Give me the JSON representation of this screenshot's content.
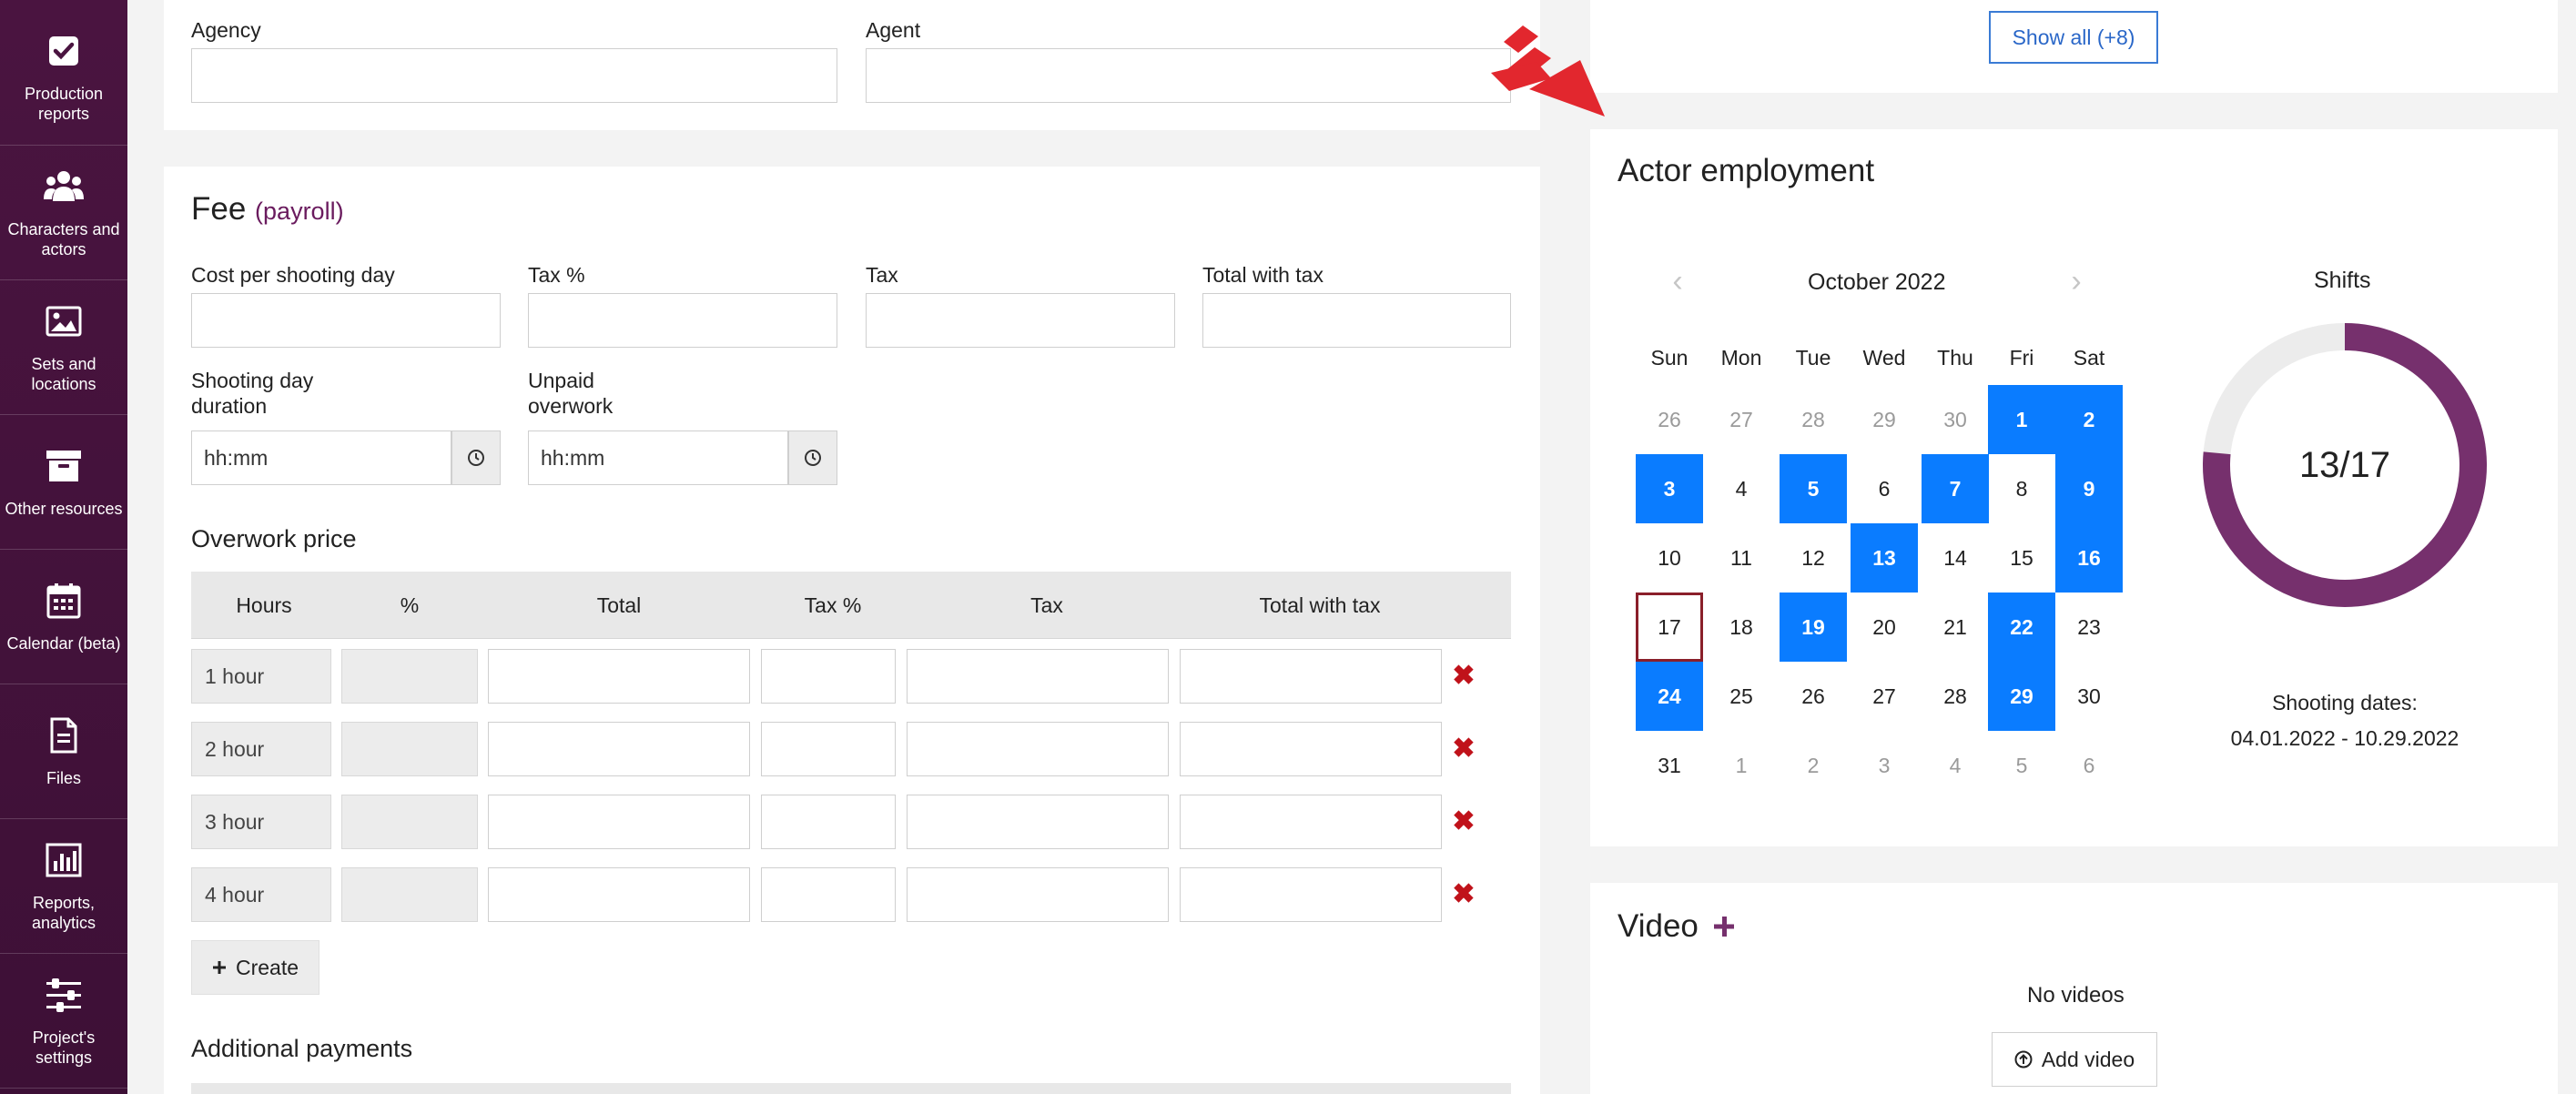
{
  "sidebar": {
    "items": [
      {
        "label": "Production reports",
        "icon": "checkbox-icon"
      },
      {
        "label": "Characters and actors",
        "icon": "users-icon"
      },
      {
        "label": "Sets and locations",
        "icon": "image-icon"
      },
      {
        "label": "Other resources",
        "icon": "archive-icon"
      },
      {
        "label": "Calendar (beta)",
        "icon": "calendar-icon"
      },
      {
        "label": "Files",
        "icon": "file-icon"
      },
      {
        "label": "Reports, analytics",
        "icon": "bar-chart-icon"
      },
      {
        "label": "Project's settings",
        "icon": "sliders-icon"
      }
    ]
  },
  "agency": {
    "agency_label": "Agency",
    "agent_label": "Agent"
  },
  "fee": {
    "title": "Fee",
    "subtitle": "(payroll)",
    "cost_label": "Cost per shooting day",
    "tax_pct_label": "Tax %",
    "tax_label": "Tax",
    "total_label": "Total with tax",
    "duration_label_1": "Shooting day",
    "duration_label_2": "duration",
    "unpaid_label_1": "Unpaid",
    "unpaid_label_2": "overwork",
    "duration_value": "hh:mm",
    "unpaid_value": "hh:mm"
  },
  "overwork": {
    "title": "Overwork price",
    "columns": [
      "Hours",
      "%",
      "Total",
      "Tax %",
      "Tax",
      "Total with tax"
    ],
    "rows": [
      "1 hour",
      "2 hour",
      "3 hour",
      "4 hour"
    ],
    "create_label": "Create"
  },
  "additional": {
    "title": "Additional payments"
  },
  "show_all": {
    "label": "Show all (+8)"
  },
  "employment": {
    "title": "Actor employment",
    "month": "October 2022",
    "weekdays": [
      "Sun",
      "Mon",
      "Tue",
      "Wed",
      "Thu",
      "Fri",
      "Sat"
    ],
    "weeks": [
      [
        "26",
        "27",
        "28",
        "29",
        "30",
        "1",
        "2"
      ],
      [
        "3",
        "4",
        "5",
        "6",
        "7",
        "8",
        "9"
      ],
      [
        "10",
        "11",
        "12",
        "13",
        "14",
        "15",
        "16"
      ],
      [
        "17",
        "18",
        "19",
        "20",
        "21",
        "22",
        "23"
      ],
      [
        "24",
        "25",
        "26",
        "27",
        "28",
        "29",
        "30"
      ],
      [
        "31",
        "1",
        "2",
        "3",
        "4",
        "5",
        "6"
      ]
    ],
    "shifts_title": "Shifts",
    "shifts_value": "13/17",
    "shifts_done": 13,
    "shifts_total": 17,
    "shooting_label": "Shooting dates:",
    "shooting_range": "04.01.2022 - 10.29.2022",
    "accent_color": "#0a7cff",
    "donut_color": "#76306d"
  },
  "video": {
    "title": "Video",
    "empty_label": "No videos",
    "add_label": "Add video"
  }
}
